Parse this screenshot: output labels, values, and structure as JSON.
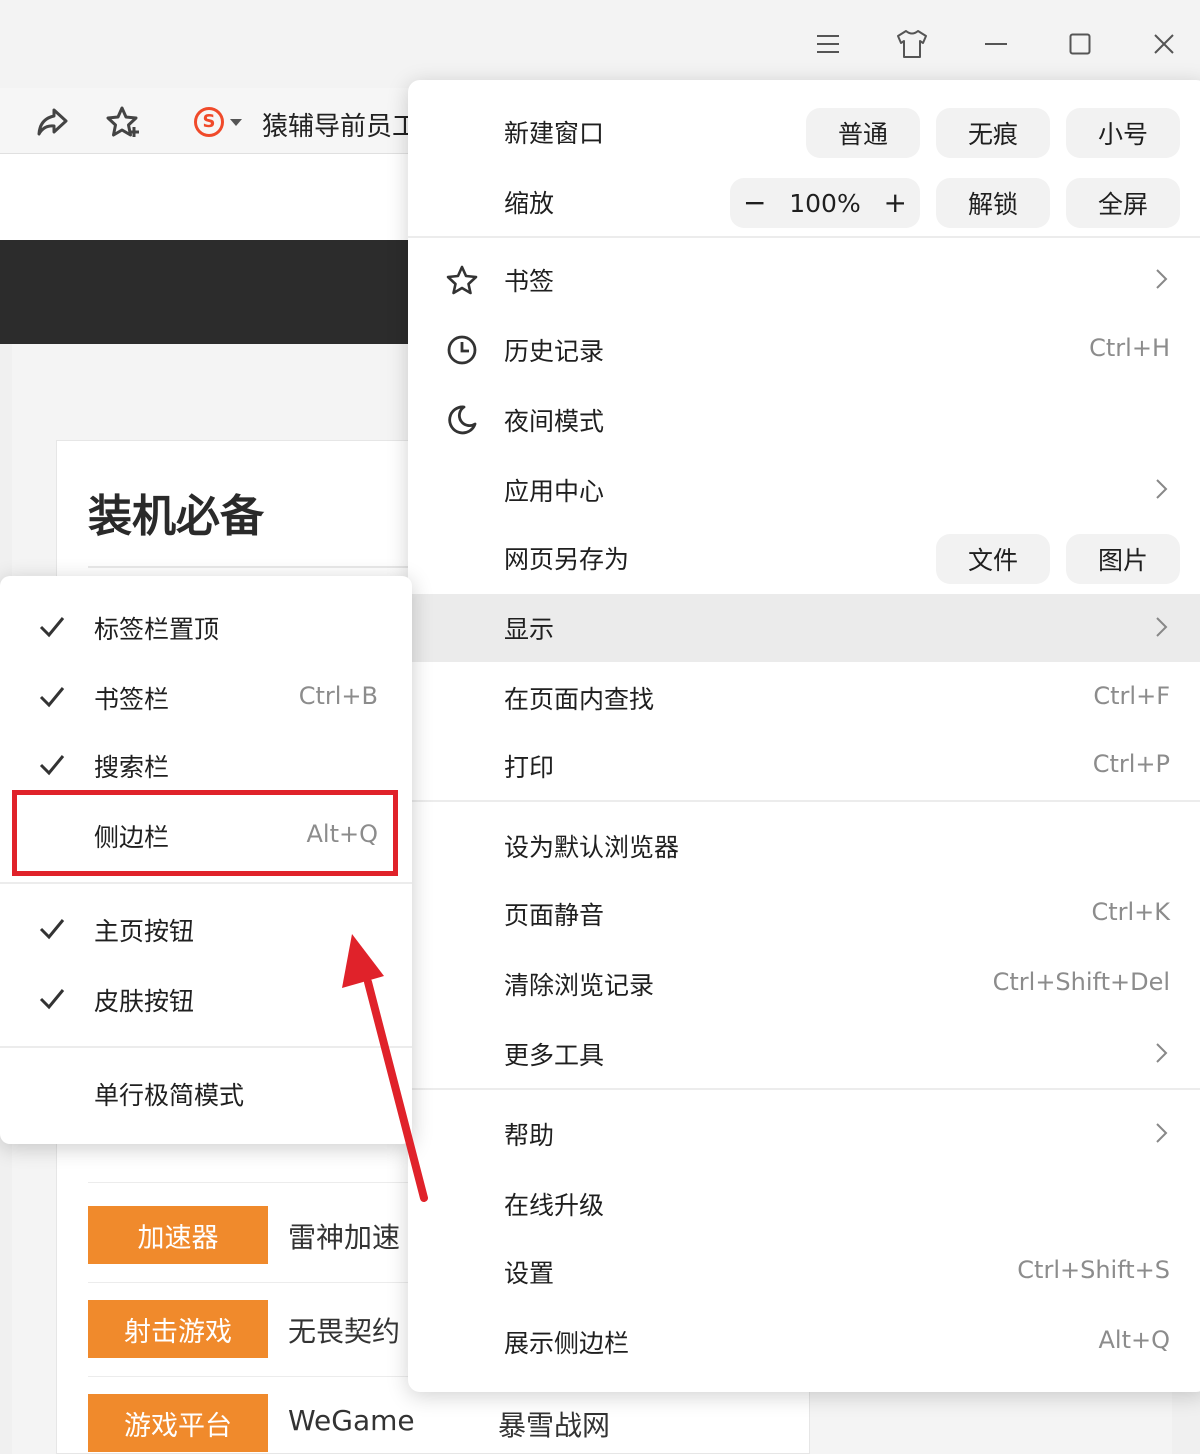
{
  "titlebar": {
    "icons": [
      "menu-icon",
      "skin-icon",
      "minimize-icon",
      "maximize-icon",
      "close-icon"
    ]
  },
  "toolbar": {
    "icons": [
      "share-icon",
      "favorite-star-icon"
    ],
    "search_engine_letter": "S",
    "search_text": "猿辅导前员工"
  },
  "page": {
    "card_title": "装机必备",
    "categories": [
      {
        "tag": "加速器",
        "items": [
          "雷神加速",
          ""
        ]
      },
      {
        "tag": "射击游戏",
        "items": [
          "无畏契约",
          ""
        ]
      },
      {
        "tag": "游戏平台",
        "items": [
          "WeGame",
          "暴雪战网"
        ]
      }
    ],
    "accent_color": "#f08a2c"
  },
  "menu": {
    "new_window": {
      "label": "新建窗口",
      "buttons": [
        "普通",
        "无痕",
        "小号"
      ]
    },
    "zoom": {
      "label": "缩放",
      "minus": "−",
      "value": "100%",
      "plus": "+",
      "buttons": [
        "解锁",
        "全屏"
      ]
    },
    "items": [
      {
        "label": "书签",
        "icon": "star-icon",
        "submenu": true
      },
      {
        "label": "历史记录",
        "icon": "clock-icon",
        "shortcut": "Ctrl+H"
      },
      {
        "label": "夜间模式",
        "icon": "moon-icon"
      },
      {
        "label": "应用中心",
        "submenu": true
      },
      {
        "label": "网页另存为",
        "buttons": [
          "文件",
          "图片"
        ]
      },
      {
        "label": "显示",
        "submenu": true,
        "highlighted": true
      },
      {
        "label": "在页面内查找",
        "shortcut": "Ctrl+F"
      },
      {
        "label": "打印",
        "shortcut": "Ctrl+P"
      },
      {
        "label": "设为默认浏览器"
      },
      {
        "label": "页面静音",
        "shortcut": "Ctrl+K"
      },
      {
        "label": "清除浏览记录",
        "shortcut": "Ctrl+Shift+Del"
      },
      {
        "label": "更多工具",
        "submenu": true
      },
      {
        "label": "帮助",
        "submenu": true
      },
      {
        "label": "在线升级"
      },
      {
        "label": "设置",
        "shortcut": "Ctrl+Shift+S"
      },
      {
        "label": "展示侧边栏",
        "shortcut": "Alt+Q"
      }
    ]
  },
  "display_submenu": {
    "items": [
      {
        "label": "标签栏置顶",
        "checked": true
      },
      {
        "label": "书签栏",
        "checked": true,
        "shortcut": "Ctrl+B"
      },
      {
        "label": "搜索栏",
        "checked": true
      },
      {
        "label": "侧边栏",
        "checked": false,
        "shortcut": "Alt+Q",
        "annotated": true
      },
      {
        "label": "主页按钮",
        "checked": true
      },
      {
        "label": "皮肤按钮",
        "checked": true
      },
      {
        "label": "单行极简模式",
        "checked": false
      }
    ],
    "annotation_color": "#e0222a"
  }
}
